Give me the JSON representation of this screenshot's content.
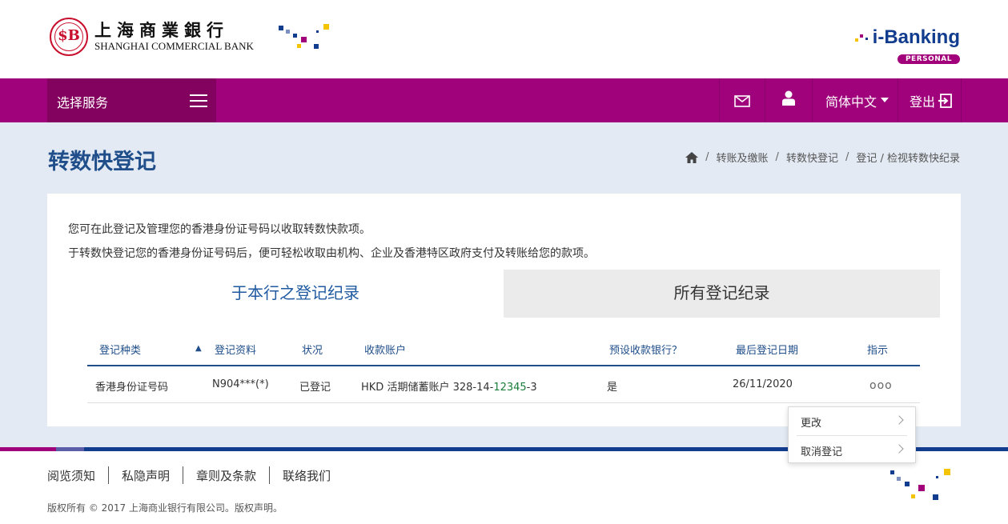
{
  "header": {
    "bank_name_cn": "上海商業銀行",
    "bank_name_en": "SHANGHAI COMMERCIAL BANK",
    "logo_seal_text": "$B",
    "ibanking_word": "i-Banking",
    "ibanking_badge": "PERSONAL",
    "pixel_colors": [
      "#123d8f",
      "#a1007a",
      "#f5c400",
      "#7b8fc0"
    ]
  },
  "nav": {
    "service_label": "选择服务",
    "language": "简体中文",
    "logout": "登出",
    "icons": [
      "menu-icon",
      "mail-icon",
      "user-icon",
      "caret-down-icon",
      "logout-icon"
    ],
    "color": "#a0027c"
  },
  "page": {
    "title": "转数快登记",
    "breadcrumb": [
      "转账及缴账",
      "转数快登记",
      "登记 / 检视转数快纪录"
    ]
  },
  "card": {
    "intro_1": "您可在此登记及管理您的香港身份证号码以收取转数快款项。",
    "intro_2": "于转数快登记您的香港身份证号码后，便可轻松收取由机构、企业及香港特区政府支付及转账给您的款项。",
    "tabs": [
      "于本行之登记纪录",
      "所有登记纪录"
    ],
    "table": {
      "headers": [
        "登记种类",
        "登记资料",
        "状况",
        "收款账户",
        "预设收款银行？",
        "最后登记日期",
        "指示"
      ],
      "sort_indicator": "▲",
      "rows": [
        {
          "type": "香港身份证号码",
          "info": "N904***(*)",
          "status": "已登记",
          "account_prefix": "HKD 活期储蓄账户 328-14-",
          "account_highlight": "12345",
          "account_suffix": "-3",
          "default_bank": "是",
          "last_date": "26/11/2020",
          "action": "ooo"
        }
      ]
    }
  },
  "action_menu": {
    "items": [
      "更改",
      "取消登记"
    ]
  },
  "footer": {
    "links": [
      "阅览须知",
      "私隐声明",
      "章则及条款",
      "联络我们"
    ],
    "copyright": "版权所有 © 2017 上海商业银行有限公司。版权声明。"
  }
}
